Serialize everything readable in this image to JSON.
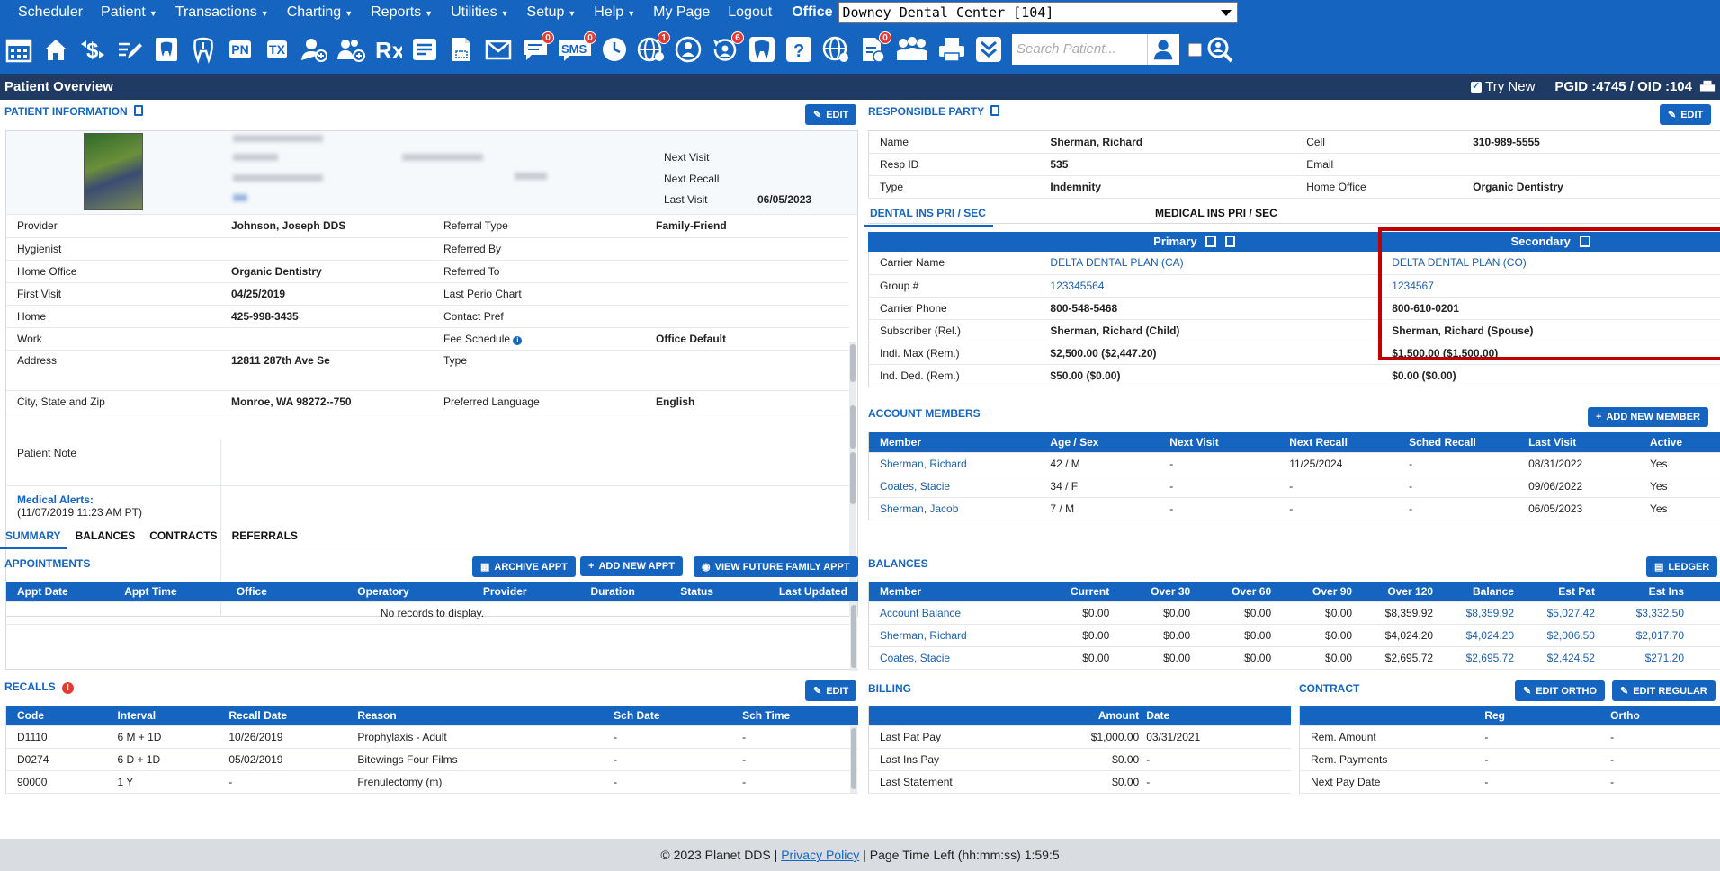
{
  "menu": {
    "items": [
      "Scheduler",
      "Patient",
      "Transactions",
      "Charting",
      "Reports",
      "Utilities",
      "Setup",
      "Help",
      "My Page",
      "Logout"
    ],
    "dropdowns": [
      false,
      true,
      true,
      true,
      true,
      true,
      true,
      true,
      false,
      false
    ],
    "office_label": "Office",
    "office_value": "Downey Dental Center [104]"
  },
  "toolbar": {
    "pn": "PN",
    "tx": "TX",
    "sms": "SMS",
    "badges": {
      "messages": "0",
      "sms": "0",
      "globe_person": "1",
      "history": "6",
      "doc_alert": "0"
    },
    "search_placeholder": "Search Patient..."
  },
  "header": {
    "title": "Patient Overview",
    "try_new": "Try New",
    "ids": "PGID :4745  /  OID :104"
  },
  "patient_info": {
    "title": "PATIENT INFORMATION",
    "edit": "EDIT",
    "next_visit_label": "Next Visit",
    "next_recall_label": "Next Recall",
    "last_visit_label": "Last Visit",
    "last_visit_value": "06/05/2023",
    "rows": [
      {
        "l1": "Provider",
        "v1": "Johnson, Joseph DDS",
        "l2": "Referral Type",
        "v2": "Family-Friend"
      },
      {
        "l1": "Hygienist",
        "v1": "",
        "l2": "Referred By",
        "v2": ""
      },
      {
        "l1": "Home Office",
        "v1": "Organic Dentistry",
        "l2": "Referred To",
        "v2": ""
      },
      {
        "l1": "First Visit",
        "v1": "04/25/2019",
        "l2": "Last Perio Chart",
        "v2": ""
      },
      {
        "l1": "Home",
        "v1": "425-998-3435",
        "l2": "Contact Pref",
        "v2": ""
      },
      {
        "l1": "Work",
        "v1": "",
        "l2": "Fee Schedule",
        "v2": "Office Default"
      },
      {
        "l1": "Address",
        "v1": "12811 287th Ave Se",
        "l2": "Type",
        "v2": ""
      },
      {
        "l1": "City, State and Zip",
        "v1": "Monroe, WA 98272--750",
        "l2": "Preferred Language",
        "v2": "English"
      }
    ],
    "patient_note_label": "Patient Note",
    "medical_alerts_label": "Medical Alerts:",
    "medical_alerts_time": "(11/07/2019 11:23 AM PT)"
  },
  "responsible_party": {
    "title": "RESPONSIBLE PARTY",
    "edit": "EDIT",
    "rows": [
      {
        "l1": "Name",
        "v1": "Sherman, Richard",
        "l2": "Cell",
        "v2": "310-989-5555"
      },
      {
        "l1": "Resp ID",
        "v1": "535",
        "l2": "Email",
        "v2": ""
      },
      {
        "l1": "Type",
        "v1": "Indemnity",
        "l2": "Home Office",
        "v2": "Organic Dentistry"
      }
    ]
  },
  "insurance": {
    "tab_dental": "DENTAL INS PRI / SEC",
    "tab_medical": "MEDICAL INS PRI / SEC",
    "primary_label": "Primary",
    "secondary_label": "Secondary",
    "rows": [
      {
        "label": "Carrier Name",
        "pri": "DELTA DENTAL PLAN (CA)",
        "sec": "DELTA DENTAL PLAN (CO)",
        "link": true
      },
      {
        "label": "Group #",
        "pri": "123345564",
        "sec": "1234567",
        "link": true
      },
      {
        "label": "Carrier Phone",
        "pri": "800-548-5468",
        "sec": "800-610-0201",
        "link": false
      },
      {
        "label": "Subscriber (Rel.)",
        "pri": "Sherman, Richard (Child)",
        "sec": "Sherman, Richard (Spouse)",
        "link": false
      },
      {
        "label": "Indi. Max (Rem.)",
        "pri": "$2,500.00 ($2,447.20)",
        "sec": "$1,500.00 ($1,500.00)",
        "link": false
      },
      {
        "label": "Ind. Ded. (Rem.)",
        "pri": "$50.00 ($0.00)",
        "sec": "$0.00 ($0.00)",
        "link": false
      }
    ],
    "highlight_color": "#c00000"
  },
  "account_members": {
    "title": "ACCOUNT MEMBERS",
    "add_button": "ADD NEW MEMBER",
    "columns": [
      "Member",
      "Age / Sex",
      "Next Visit",
      "Next Recall",
      "Sched Recall",
      "Last Visit",
      "Active"
    ],
    "rows": [
      [
        "Sherman, Richard",
        "42 / M",
        "-",
        "11/25/2024",
        "-",
        "08/31/2022",
        "Yes"
      ],
      [
        "Coates, Stacie",
        "34 / F",
        "-",
        "-",
        "-",
        "09/06/2022",
        "Yes"
      ],
      [
        "Sherman, Jacob",
        "7 / M",
        "-",
        "-",
        "-",
        "06/05/2023",
        "Yes"
      ]
    ]
  },
  "bottom_tabs": [
    "SUMMARY",
    "BALANCES",
    "CONTRACTS",
    "REFERRALS"
  ],
  "appointments": {
    "title": "APPOINTMENTS",
    "buttons": [
      "ARCHIVE APPT",
      "ADD NEW APPT",
      "VIEW FUTURE FAMILY APPT"
    ],
    "columns": [
      "Appt Date",
      "Appt Time",
      "Office",
      "Operatory",
      "Provider",
      "Duration",
      "Status",
      "Last Updated"
    ],
    "empty": "No records to display."
  },
  "balances": {
    "title": "BALANCES",
    "ledger": "LEDGER",
    "columns": [
      "Member",
      "Current",
      "Over 30",
      "Over 60",
      "Over 90",
      "Over 120",
      "Balance",
      "Est Pat",
      "Est Ins"
    ],
    "rows": [
      [
        "Account Balance",
        "$0.00",
        "$0.00",
        "$0.00",
        "$0.00",
        "$8,359.92",
        "$8,359.92",
        "$5,027.42",
        "$3,332.50"
      ],
      [
        "Sherman, Richard",
        "$0.00",
        "$0.00",
        "$0.00",
        "$0.00",
        "$4,024.20",
        "$4,024.20",
        "$2,006.50",
        "$2,017.70"
      ],
      [
        "Coates, Stacie",
        "$0.00",
        "$0.00",
        "$0.00",
        "$0.00",
        "$2,695.72",
        "$2,695.72",
        "$2,424.52",
        "$271.20"
      ]
    ]
  },
  "recalls": {
    "title": "RECALLS",
    "alert": "!",
    "edit": "EDIT",
    "columns": [
      "Code",
      "Interval",
      "Recall Date",
      "Reason",
      "Sch Date",
      "Sch Time"
    ],
    "rows": [
      [
        "D1110",
        "6 M + 1D",
        "10/26/2019",
        "Prophylaxis - Adult",
        "-",
        "-"
      ],
      [
        "D0274",
        "6 D + 1D",
        "05/02/2019",
        "Bitewings Four Films",
        "-",
        "-"
      ],
      [
        "90000",
        "1 Y",
        "-",
        "Frenulectomy (m)",
        "-",
        "-"
      ]
    ]
  },
  "billing": {
    "title": "BILLING",
    "columns": [
      "",
      "Amount",
      "Date"
    ],
    "rows": [
      [
        "Last Pat Pay",
        "$1,000.00",
        "03/31/2021"
      ],
      [
        "Last Ins Pay",
        "$0.00",
        "-"
      ],
      [
        "Last Statement",
        "$0.00",
        "-"
      ]
    ]
  },
  "contract": {
    "title": "CONTRACT",
    "edit_ortho": "EDIT ORTHO",
    "edit_regular": "EDIT REGULAR",
    "columns": [
      "",
      "Reg",
      "Ortho"
    ],
    "rows": [
      [
        "Rem. Amount",
        "-",
        "-"
      ],
      [
        "Rem. Payments",
        "-",
        "-"
      ],
      [
        "Next Pay Date",
        "-",
        "-"
      ]
    ]
  },
  "footer": {
    "copyright": "© 2023 Planet DDS |",
    "privacy": "Privacy Policy",
    "time_left": "|  Page Time Left (hh:mm:ss) 1:59:5"
  },
  "colors": {
    "primary": "#1565c0",
    "header_dark": "#1f3b63",
    "badge": "#e53935"
  }
}
